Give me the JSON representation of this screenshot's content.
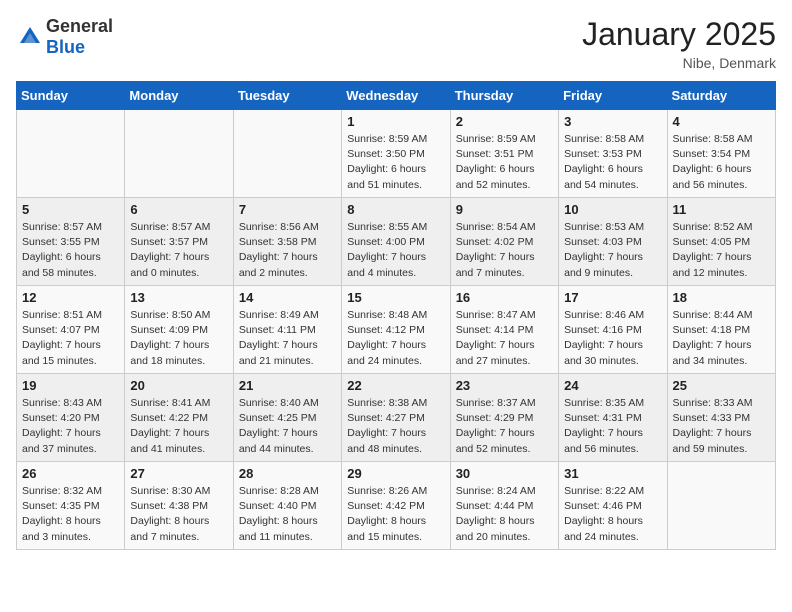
{
  "logo": {
    "general": "General",
    "blue": "Blue"
  },
  "title": "January 2025",
  "subtitle": "Nibe, Denmark",
  "days_header": [
    "Sunday",
    "Monday",
    "Tuesday",
    "Wednesday",
    "Thursday",
    "Friday",
    "Saturday"
  ],
  "weeks": [
    [
      {
        "day": "",
        "content": ""
      },
      {
        "day": "",
        "content": ""
      },
      {
        "day": "",
        "content": ""
      },
      {
        "day": "1",
        "content": "Sunrise: 8:59 AM\nSunset: 3:50 PM\nDaylight: 6 hours\nand 51 minutes."
      },
      {
        "day": "2",
        "content": "Sunrise: 8:59 AM\nSunset: 3:51 PM\nDaylight: 6 hours\nand 52 minutes."
      },
      {
        "day": "3",
        "content": "Sunrise: 8:58 AM\nSunset: 3:53 PM\nDaylight: 6 hours\nand 54 minutes."
      },
      {
        "day": "4",
        "content": "Sunrise: 8:58 AM\nSunset: 3:54 PM\nDaylight: 6 hours\nand 56 minutes."
      }
    ],
    [
      {
        "day": "5",
        "content": "Sunrise: 8:57 AM\nSunset: 3:55 PM\nDaylight: 6 hours\nand 58 minutes."
      },
      {
        "day": "6",
        "content": "Sunrise: 8:57 AM\nSunset: 3:57 PM\nDaylight: 7 hours\nand 0 minutes."
      },
      {
        "day": "7",
        "content": "Sunrise: 8:56 AM\nSunset: 3:58 PM\nDaylight: 7 hours\nand 2 minutes."
      },
      {
        "day": "8",
        "content": "Sunrise: 8:55 AM\nSunset: 4:00 PM\nDaylight: 7 hours\nand 4 minutes."
      },
      {
        "day": "9",
        "content": "Sunrise: 8:54 AM\nSunset: 4:02 PM\nDaylight: 7 hours\nand 7 minutes."
      },
      {
        "day": "10",
        "content": "Sunrise: 8:53 AM\nSunset: 4:03 PM\nDaylight: 7 hours\nand 9 minutes."
      },
      {
        "day": "11",
        "content": "Sunrise: 8:52 AM\nSunset: 4:05 PM\nDaylight: 7 hours\nand 12 minutes."
      }
    ],
    [
      {
        "day": "12",
        "content": "Sunrise: 8:51 AM\nSunset: 4:07 PM\nDaylight: 7 hours\nand 15 minutes."
      },
      {
        "day": "13",
        "content": "Sunrise: 8:50 AM\nSunset: 4:09 PM\nDaylight: 7 hours\nand 18 minutes."
      },
      {
        "day": "14",
        "content": "Sunrise: 8:49 AM\nSunset: 4:11 PM\nDaylight: 7 hours\nand 21 minutes."
      },
      {
        "day": "15",
        "content": "Sunrise: 8:48 AM\nSunset: 4:12 PM\nDaylight: 7 hours\nand 24 minutes."
      },
      {
        "day": "16",
        "content": "Sunrise: 8:47 AM\nSunset: 4:14 PM\nDaylight: 7 hours\nand 27 minutes."
      },
      {
        "day": "17",
        "content": "Sunrise: 8:46 AM\nSunset: 4:16 PM\nDaylight: 7 hours\nand 30 minutes."
      },
      {
        "day": "18",
        "content": "Sunrise: 8:44 AM\nSunset: 4:18 PM\nDaylight: 7 hours\nand 34 minutes."
      }
    ],
    [
      {
        "day": "19",
        "content": "Sunrise: 8:43 AM\nSunset: 4:20 PM\nDaylight: 7 hours\nand 37 minutes."
      },
      {
        "day": "20",
        "content": "Sunrise: 8:41 AM\nSunset: 4:22 PM\nDaylight: 7 hours\nand 41 minutes."
      },
      {
        "day": "21",
        "content": "Sunrise: 8:40 AM\nSunset: 4:25 PM\nDaylight: 7 hours\nand 44 minutes."
      },
      {
        "day": "22",
        "content": "Sunrise: 8:38 AM\nSunset: 4:27 PM\nDaylight: 7 hours\nand 48 minutes."
      },
      {
        "day": "23",
        "content": "Sunrise: 8:37 AM\nSunset: 4:29 PM\nDaylight: 7 hours\nand 52 minutes."
      },
      {
        "day": "24",
        "content": "Sunrise: 8:35 AM\nSunset: 4:31 PM\nDaylight: 7 hours\nand 56 minutes."
      },
      {
        "day": "25",
        "content": "Sunrise: 8:33 AM\nSunset: 4:33 PM\nDaylight: 7 hours\nand 59 minutes."
      }
    ],
    [
      {
        "day": "26",
        "content": "Sunrise: 8:32 AM\nSunset: 4:35 PM\nDaylight: 8 hours\nand 3 minutes."
      },
      {
        "day": "27",
        "content": "Sunrise: 8:30 AM\nSunset: 4:38 PM\nDaylight: 8 hours\nand 7 minutes."
      },
      {
        "day": "28",
        "content": "Sunrise: 8:28 AM\nSunset: 4:40 PM\nDaylight: 8 hours\nand 11 minutes."
      },
      {
        "day": "29",
        "content": "Sunrise: 8:26 AM\nSunset: 4:42 PM\nDaylight: 8 hours\nand 15 minutes."
      },
      {
        "day": "30",
        "content": "Sunrise: 8:24 AM\nSunset: 4:44 PM\nDaylight: 8 hours\nand 20 minutes."
      },
      {
        "day": "31",
        "content": "Sunrise: 8:22 AM\nSunset: 4:46 PM\nDaylight: 8 hours\nand 24 minutes."
      },
      {
        "day": "",
        "content": ""
      }
    ]
  ]
}
